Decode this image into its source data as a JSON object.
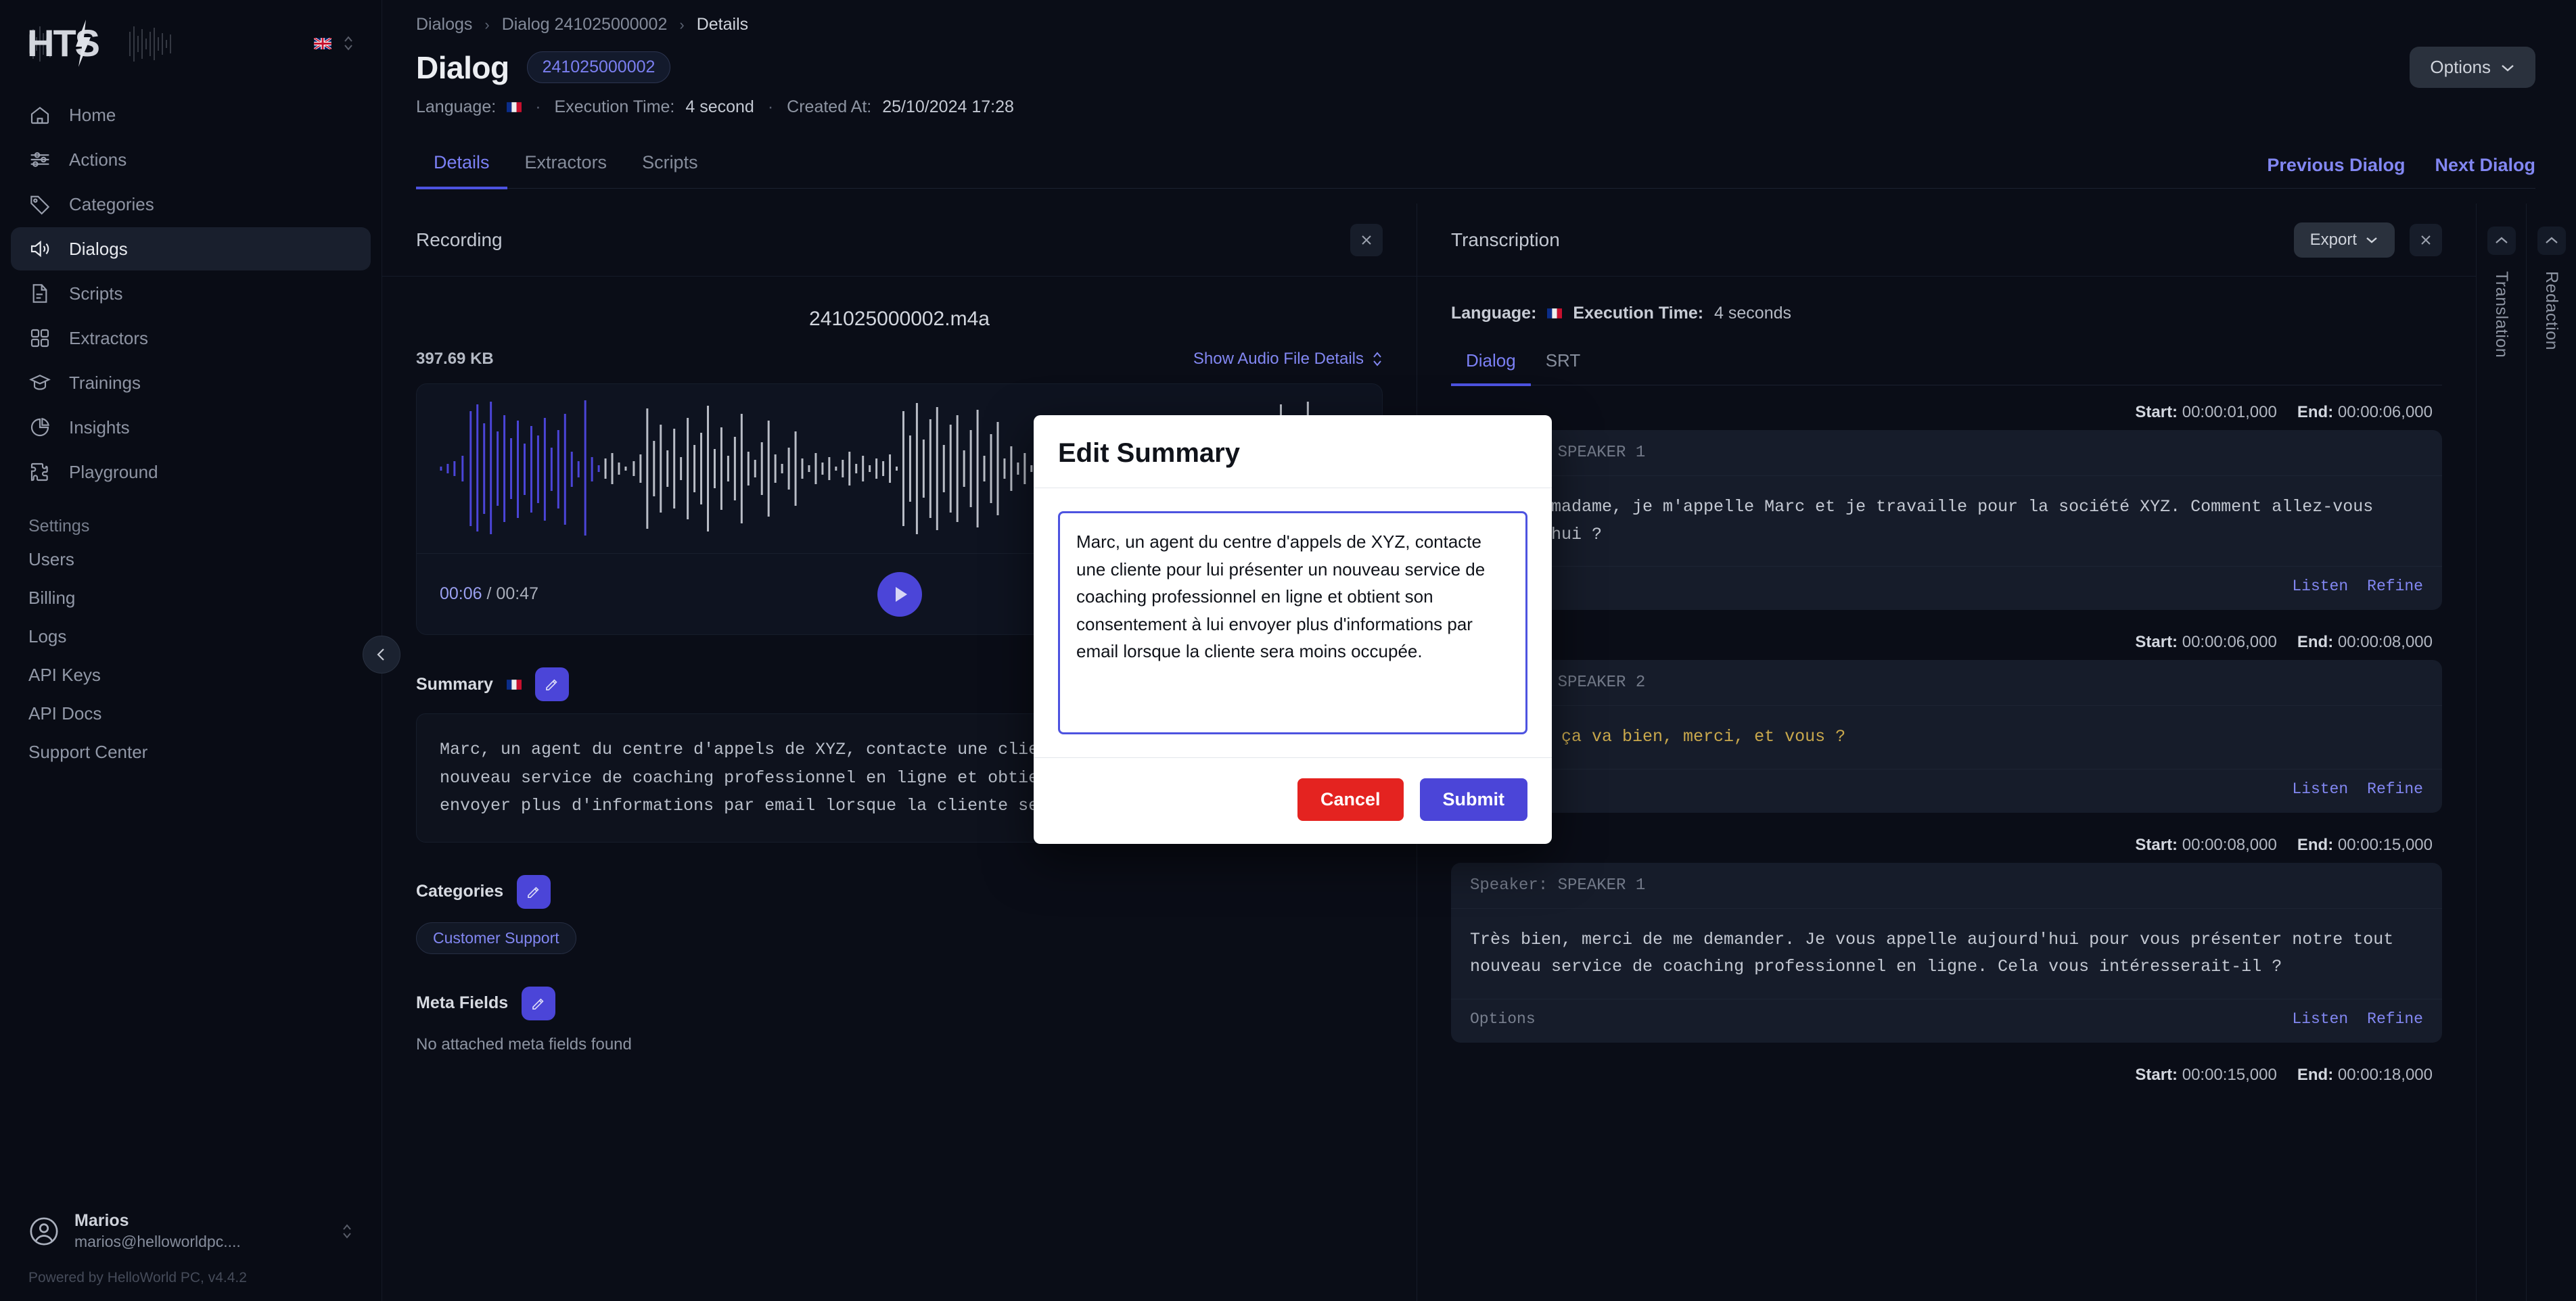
{
  "sidebar": {
    "logo_text": "HTS",
    "language_flag": "uk-flag-icon",
    "nav": [
      {
        "label": "Home",
        "icon": "home-icon"
      },
      {
        "label": "Actions",
        "icon": "sliders-icon"
      },
      {
        "label": "Categories",
        "icon": "tag-icon"
      },
      {
        "label": "Dialogs",
        "icon": "speaker-icon",
        "active": true
      },
      {
        "label": "Scripts",
        "icon": "document-icon"
      },
      {
        "label": "Extractors",
        "icon": "grid-icon"
      },
      {
        "label": "Trainings",
        "icon": "graduation-cap-icon"
      },
      {
        "label": "Insights",
        "icon": "pie-chart-icon"
      },
      {
        "label": "Playground",
        "icon": "puzzle-icon"
      }
    ],
    "settings_heading": "Settings",
    "settings_items": [
      {
        "label": "Users"
      },
      {
        "label": "Billing"
      },
      {
        "label": "Logs"
      },
      {
        "label": "API Keys"
      },
      {
        "label": "API Docs"
      },
      {
        "label": "Support Center"
      }
    ],
    "user": {
      "name": "Marios",
      "email": "marios@helloworldpc...."
    },
    "powered_by": "Powered by HelloWorld PC, v4.4.2"
  },
  "header": {
    "breadcrumb": [
      "Dialogs",
      "Dialog 241025000002",
      "Details"
    ],
    "title": "Dialog",
    "id_chip": "241025000002",
    "options_label": "Options",
    "meta": {
      "language_label": "Language:",
      "language_flag": "fr-flag-icon",
      "execution_time_label": "Execution Time:",
      "execution_time_value": "4 second",
      "created_at_label": "Created At:",
      "created_at_value": "25/10/2024 17:28"
    },
    "tabs": [
      {
        "label": "Details",
        "active": true
      },
      {
        "label": "Extractors",
        "active": false
      },
      {
        "label": "Scripts",
        "active": false
      }
    ],
    "prev_dialog": "Previous Dialog",
    "next_dialog": "Next Dialog"
  },
  "recording": {
    "panel_title": "Recording",
    "file_name": "241025000002.m4a",
    "file_size": "397.69 KB",
    "show_details_label": "Show Audio File Details",
    "current_time": "00:06",
    "total_time": "00:47",
    "time_separator": "/",
    "summary": {
      "label": "Summary",
      "flag": "fr-flag-icon",
      "text": "Marc, un agent du centre d'appels de XYZ, contacte une cliente pour lui présenter un nouveau service de coaching professionnel en ligne et obtient son consentement à lui envoyer plus d'informations par email lorsque la cliente sera moins occupée."
    },
    "categories": {
      "label": "Categories",
      "items": [
        "Customer Support"
      ]
    },
    "meta_fields": {
      "label": "Meta Fields",
      "empty_text": "No attached meta fields found"
    }
  },
  "transcription": {
    "panel_title": "Transcription",
    "export_label": "Export",
    "language_label": "Language:",
    "language_flag": "fr-flag-icon",
    "execution_time_label": "Execution Time:",
    "execution_time_value": "4 seconds",
    "tabs": [
      {
        "label": "Dialog",
        "active": true
      },
      {
        "label": "SRT",
        "active": false
      }
    ],
    "start_label": "Start:",
    "end_label": "End:",
    "options_label": "Options",
    "listen_label": "Listen",
    "refine_label": "Refine",
    "speaker_prefix": "Speaker:",
    "segments": [
      {
        "start": "00:00:01,000",
        "end": "00:00:06,000",
        "speaker": "SPEAKER 1",
        "text": "Bonjour madame, je m'appelle Marc et je travaille pour la société XYZ. Comment allez-vous aujourd'hui ?",
        "highlight": false
      },
      {
        "start": "00:00:06,000",
        "end": "00:00:08,000",
        "speaker": "SPEAKER 2",
        "text": "Bonjour, ça va bien, merci, et vous ?",
        "highlight": true
      },
      {
        "start": "00:00:08,000",
        "end": "00:00:15,000",
        "speaker": "SPEAKER 1",
        "text": "Très bien, merci de me demander. Je vous appelle aujourd'hui pour vous présenter notre tout nouveau service de coaching professionnel en ligne. Cela vous intéresserait-il ?",
        "highlight": false
      },
      {
        "start": "00:00:15,000",
        "end": "00:00:18,000",
        "speaker": "",
        "text": "",
        "highlight": false
      }
    ]
  },
  "rails": [
    {
      "label": "Translation"
    },
    {
      "label": "Redaction"
    }
  ],
  "modal": {
    "title": "Edit Summary",
    "textarea_value": "Marc, un agent du centre d'appels de XYZ, contacte une cliente pour lui présenter un nouveau service de coaching professionnel en ligne et obtient son consentement à lui envoyer plus d'informations par email lorsque la cliente sera moins occupée.",
    "cancel_label": "Cancel",
    "submit_label": "Submit"
  },
  "colors": {
    "background": "#0a0d17",
    "accent": "#4b45d8",
    "link": "#8287f2",
    "danger": "#e42320",
    "card": "#161c2a",
    "highlight_text": "#c9a84c"
  }
}
